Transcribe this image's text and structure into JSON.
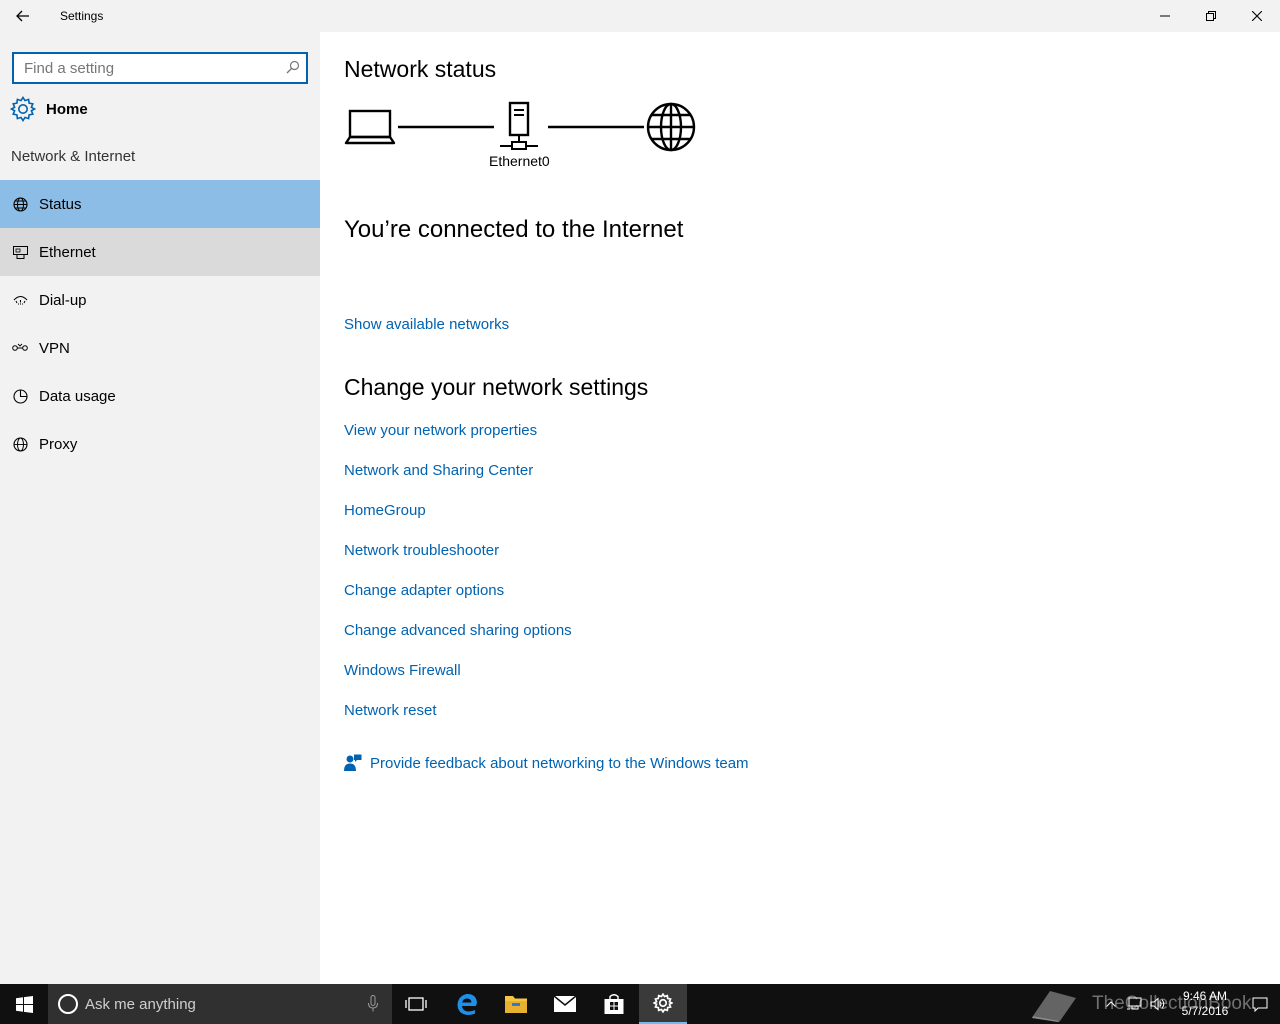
{
  "window": {
    "title": "Settings"
  },
  "sidebar": {
    "search_placeholder": "Find a setting",
    "home_label": "Home",
    "section_label": "Network & Internet",
    "items": [
      {
        "label": "Status",
        "icon": "globe-status-icon",
        "state": "selected"
      },
      {
        "label": "Ethernet",
        "icon": "ethernet-icon",
        "state": "hover"
      },
      {
        "label": "Dial-up",
        "icon": "dialup-icon",
        "state": "normal"
      },
      {
        "label": "VPN",
        "icon": "vpn-icon",
        "state": "normal"
      },
      {
        "label": "Data usage",
        "icon": "data-usage-icon",
        "state": "normal"
      },
      {
        "label": "Proxy",
        "icon": "proxy-globe-icon",
        "state": "normal"
      }
    ]
  },
  "main": {
    "network_status_title": "Network status",
    "adapter_name": "Ethernet0",
    "connected_text": "You’re connected to the Internet",
    "show_networks_link": "Show available networks",
    "change_settings_title": "Change your network settings",
    "links": [
      "View your network properties",
      "Network and Sharing Center",
      "HomeGroup",
      "Network troubleshooter",
      "Change adapter options",
      "Change advanced sharing options",
      "Windows Firewall",
      "Network reset"
    ],
    "feedback_link": "Provide feedback about networking to the Windows team"
  },
  "taskbar": {
    "search_placeholder": "Ask me anything",
    "time": "9:46 AM",
    "date": "5/7/2016",
    "watermark": "TheCollectionBook"
  },
  "colors": {
    "accent": "#0063b1",
    "selected_nav": "#8cbde6",
    "hover_nav": "#dadada",
    "sidebar_bg": "#f2f2f2",
    "taskbar_bg": "#101010"
  }
}
